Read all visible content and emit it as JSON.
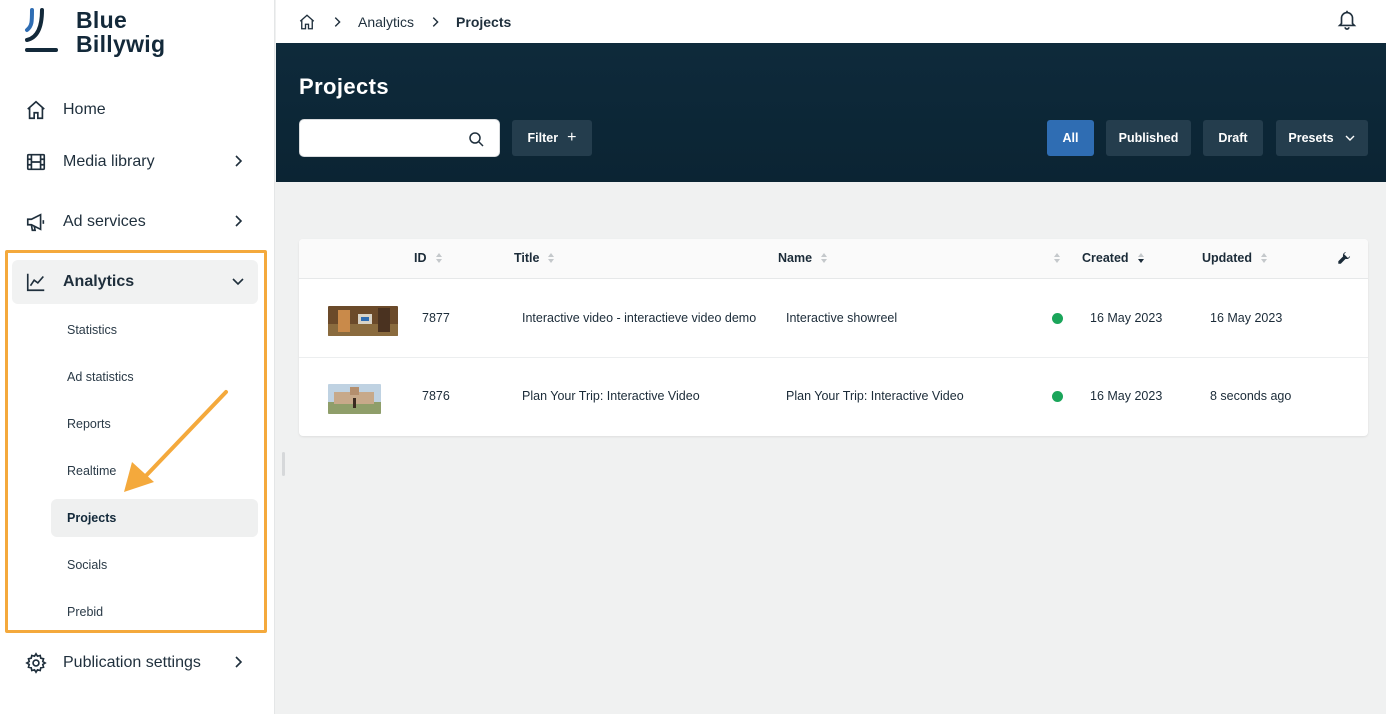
{
  "brand": {
    "line1": "Blue",
    "line2": "Billywig"
  },
  "sidebar": {
    "items": [
      {
        "label": "Home"
      },
      {
        "label": "Media library"
      },
      {
        "label": "Ad services"
      },
      {
        "label": "Analytics"
      },
      {
        "label": "Publication settings"
      }
    ],
    "analytics_sub": [
      {
        "label": "Statistics"
      },
      {
        "label": "Ad statistics"
      },
      {
        "label": "Reports"
      },
      {
        "label": "Realtime"
      },
      {
        "label": "Projects"
      },
      {
        "label": "Socials"
      },
      {
        "label": "Prebid"
      }
    ]
  },
  "breadcrumb": {
    "items": [
      "Analytics",
      "Projects"
    ]
  },
  "header": {
    "title": "Projects",
    "search_placeholder": "",
    "filter_label": "Filter",
    "tabs": [
      "All",
      "Published",
      "Draft"
    ],
    "presets_label": "Presets"
  },
  "table": {
    "columns": [
      "ID",
      "Title",
      "Name",
      "Created",
      "Updated"
    ],
    "rows": [
      {
        "id": "7877",
        "title": "Interactive video - interactieve video demo",
        "name": "Interactive showreel",
        "created": "16 May 2023",
        "updated": "16 May 2023"
      },
      {
        "id": "7876",
        "title": "Plan Your Trip: Interactive Video",
        "name": "Plan Your Trip: Interactive Video",
        "created": "16 May 2023",
        "updated": "8 seconds ago"
      }
    ]
  },
  "colors": {
    "accent": "#2f6db3",
    "header_bg": "#0e2a3b",
    "highlight": "#f4a93c",
    "status_published": "#1aa55a"
  },
  "icons": [
    "home-icon",
    "film-icon",
    "megaphone-icon",
    "chart-icon",
    "gear-icon",
    "bell-icon",
    "search-icon",
    "wrench-icon"
  ]
}
